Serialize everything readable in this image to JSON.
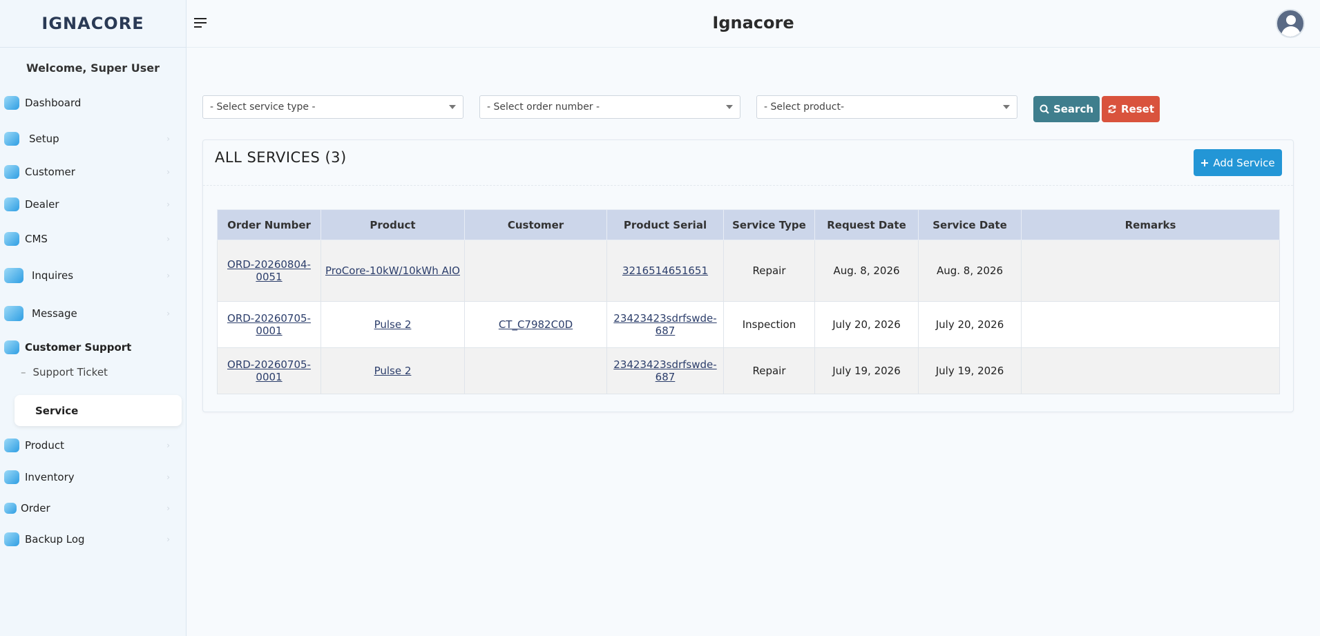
{
  "brand": {
    "logo": "IGNACORE",
    "app_title": "Ignacore"
  },
  "sidebar": {
    "welcome": "Welcome, Super User",
    "items": [
      {
        "label": "Dashboard",
        "icon": "dashboard-icon"
      },
      {
        "label": "Setup",
        "icon": "gear-icon"
      },
      {
        "label": "Customer",
        "icon": "users-icon"
      },
      {
        "label": "Dealer",
        "icon": "dealer-icon"
      },
      {
        "label": "CMS",
        "icon": "cms-icon"
      },
      {
        "label": "Inquires",
        "icon": "chat-icon"
      },
      {
        "label": "Message",
        "icon": "message-icon"
      },
      {
        "label": "Customer Support",
        "icon": "support-icon"
      },
      {
        "label": "Product",
        "icon": "product-icon"
      },
      {
        "label": "Inventory",
        "icon": "inventory-icon"
      },
      {
        "label": "Order",
        "icon": "cart-icon"
      },
      {
        "label": "Backup Log",
        "icon": "backup-icon"
      }
    ],
    "sub_items": [
      {
        "label": "Support Ticket"
      },
      {
        "label": "Service"
      }
    ]
  },
  "filters": {
    "service_type": "- Select service type -",
    "order_number": "- Select order number -",
    "product": "- Select product-",
    "search_label": "Search",
    "reset_label": "Reset"
  },
  "card": {
    "title": "ALL SERVICES (3)",
    "add_label": "Add Service"
  },
  "table": {
    "headers": [
      "Order Number",
      "Product",
      "Customer",
      "Product Serial",
      "Service Type",
      "Request Date",
      "Service Date",
      "Remarks"
    ],
    "rows": [
      {
        "order": "ORD-20260804-0051",
        "product": "ProCore-10kW/10kWh AIO",
        "customer": "",
        "serial": "3216514651651",
        "type": "Repair",
        "request": "Aug. 8, 2026",
        "service": "Aug. 8, 2026",
        "remarks": ""
      },
      {
        "order": "ORD-20260705-0001",
        "product": "Pulse 2",
        "customer": "CT_C7982C0D",
        "serial": "23423423sdrfswde-687",
        "type": "Inspection",
        "request": "July 20, 2026",
        "service": "July 20, 2026",
        "remarks": ""
      },
      {
        "order": "ORD-20260705-0001",
        "product": "Pulse 2",
        "customer": "",
        "serial": "23423423sdrfswde-687",
        "type": "Repair",
        "request": "July 19, 2026",
        "service": "July 19, 2026",
        "remarks": ""
      }
    ]
  }
}
